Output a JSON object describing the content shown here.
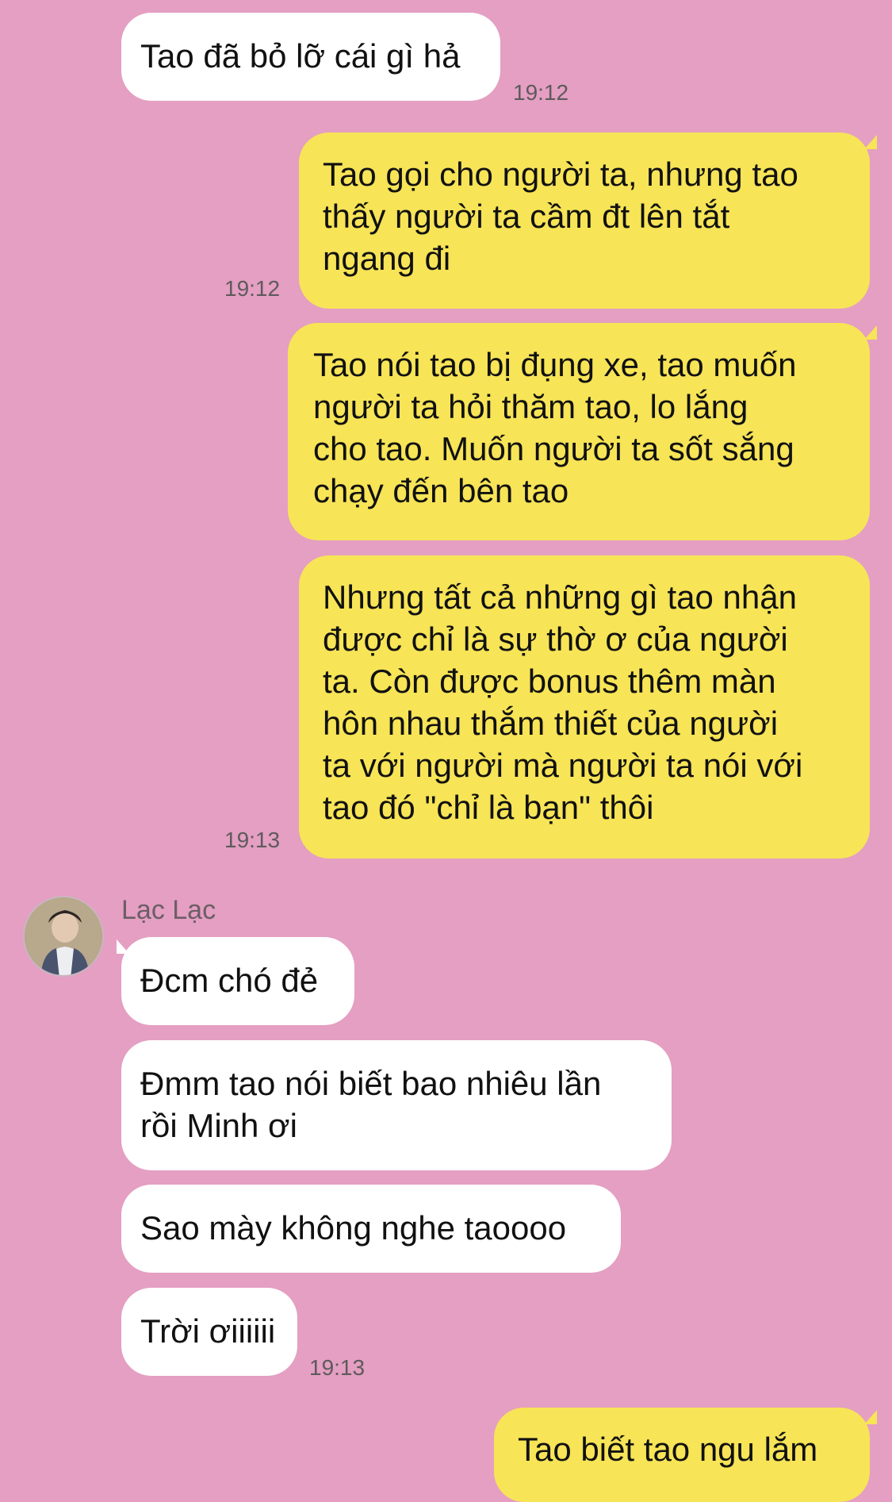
{
  "messages": [
    {
      "text": "Tao đã bỏ lỡ cái gì hả",
      "time": "19:12"
    },
    {
      "text": "Tao gọi cho người ta, nhưng tao\nthấy người ta cầm đt lên tắt\nngang đi",
      "time": "19:12"
    },
    {
      "text": "Tao nói tao bị đụng xe, tao muốn\nngười ta hỏi thăm tao, lo lắng\ncho tao. Muốn người ta sốt sắng\nchạy đến bên tao"
    },
    {
      "text": "Nhưng tất cả những gì tao nhận\nđược chỉ là sự thờ ơ của người\nta. Còn được bonus thêm màn\nhôn nhau thắm thiết của người\nta với người mà người ta nói với\ntao đó \"chỉ là bạn\" thôi",
      "time": "19:13"
    },
    {
      "text": "Đcm chó đẻ"
    },
    {
      "text": "Đmm tao nói biết bao nhiêu lần\nrồi Minh ơi"
    },
    {
      "text": "Sao mày không nghe taoooo"
    },
    {
      "text": "Trời ơiiiiii",
      "time": "19:13"
    },
    {
      "text": "Tao biết tao ngu lắm"
    }
  ],
  "contact": {
    "name": "Lạc Lạc",
    "avatar_icon": "user-avatar-photo"
  },
  "colors": {
    "background": "#e49fc2",
    "incoming": "#ffffff",
    "outgoing": "#f7e457"
  }
}
